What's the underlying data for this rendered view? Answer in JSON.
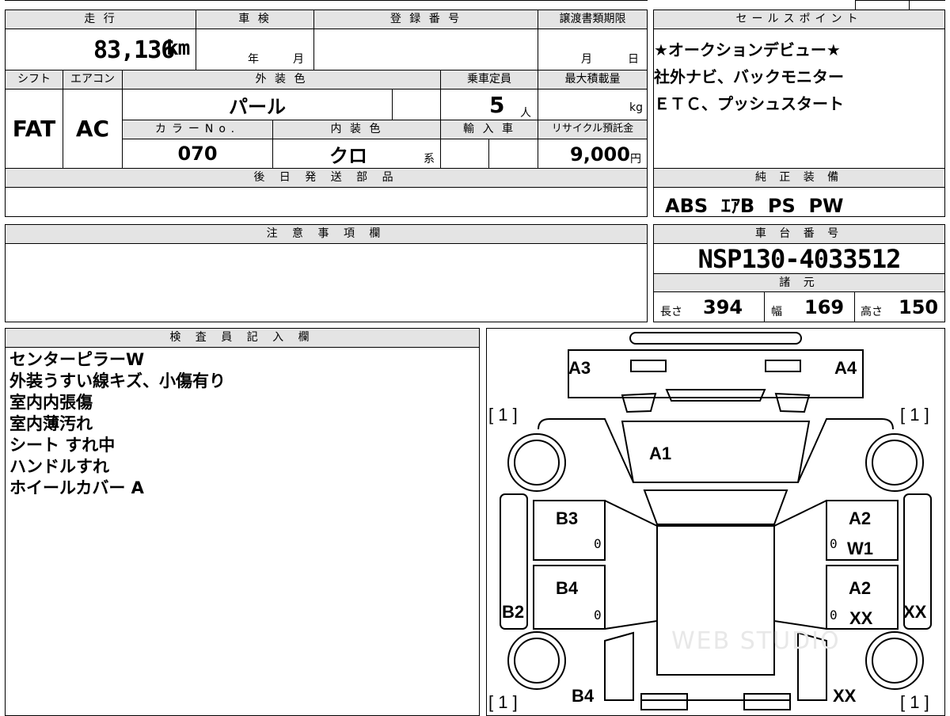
{
  "top": {
    "mileage_label": "走 行",
    "mileage_value": "83,136",
    "mileage_unit": "km",
    "inspection_label": "車 検",
    "inspection_year": "年",
    "inspection_month": "月",
    "registration_label": "登 録 番 号",
    "transfer_label": "譲渡書類期限",
    "transfer_month": "月",
    "transfer_day": "日",
    "shift_label": "シフト",
    "shift_value": "FAT",
    "ac_label": "エアコン",
    "ac_value": "AC",
    "exterior_label": "外 装 色",
    "exterior_value": "パール",
    "capacity_label": "乗車定員",
    "capacity_value": "5",
    "capacity_unit": "人",
    "load_label": "最大積載量",
    "load_unit": "kg",
    "color_no_label": "カラーNo.",
    "color_no_value": "070",
    "interior_label": "内 装 色",
    "interior_value": "クロ",
    "interior_suffix": "系",
    "import_label": "輸 入 車",
    "recycle_label": "リサイクル預託金",
    "recycle_value": "9,000",
    "recycle_unit": "円",
    "later_parts_label": "後 日 発 送 部 品"
  },
  "sales": {
    "label": "セールスポイント",
    "lines": [
      "★オークションデビュー★",
      "社外ナビ、バックモニター",
      "ＥＴＣ、プッシュスタート"
    ]
  },
  "equipment": {
    "label": "純 正 装 備",
    "value": "ABS  ｴｱB  PS  PW"
  },
  "notes": {
    "label": "注 意 事 項 欄"
  },
  "chassis": {
    "label": "車 台 番 号",
    "value": "NSP130-4033512",
    "spec_label": "諸 元",
    "length_label": "長さ",
    "length_value": "394",
    "width_label": "幅",
    "width_value": "169",
    "height_label": "高さ",
    "height_value": "150"
  },
  "inspector": {
    "label": "検 査 員 記 入 欄",
    "lines": [
      "センターピラーW",
      "外装うすい線キズ、小傷有り",
      "室内内張傷",
      "室内薄汚れ",
      "シート すれ中",
      "ハンドルすれ",
      "ホイールカバー A"
    ]
  },
  "diagram": {
    "marks": {
      "a3": "A3",
      "a4": "A4",
      "a1": "A1",
      "b3": "B3",
      "a2_top": "A2",
      "w1": "W1",
      "b4_mid": "B4",
      "a2_mid": "A2",
      "xx_mid": "XX",
      "b2": "B2",
      "xx_right": "XX",
      "b4_bottom": "B4",
      "xx_bottom": "XX"
    },
    "brackets": [
      "[ 1 ]",
      "[ 1 ]",
      "[ 1 ]",
      "[ 1 ]"
    ],
    "zeros": [
      "0",
      "0",
      "0",
      "0"
    ],
    "watermark": "WEB STUDIO"
  }
}
